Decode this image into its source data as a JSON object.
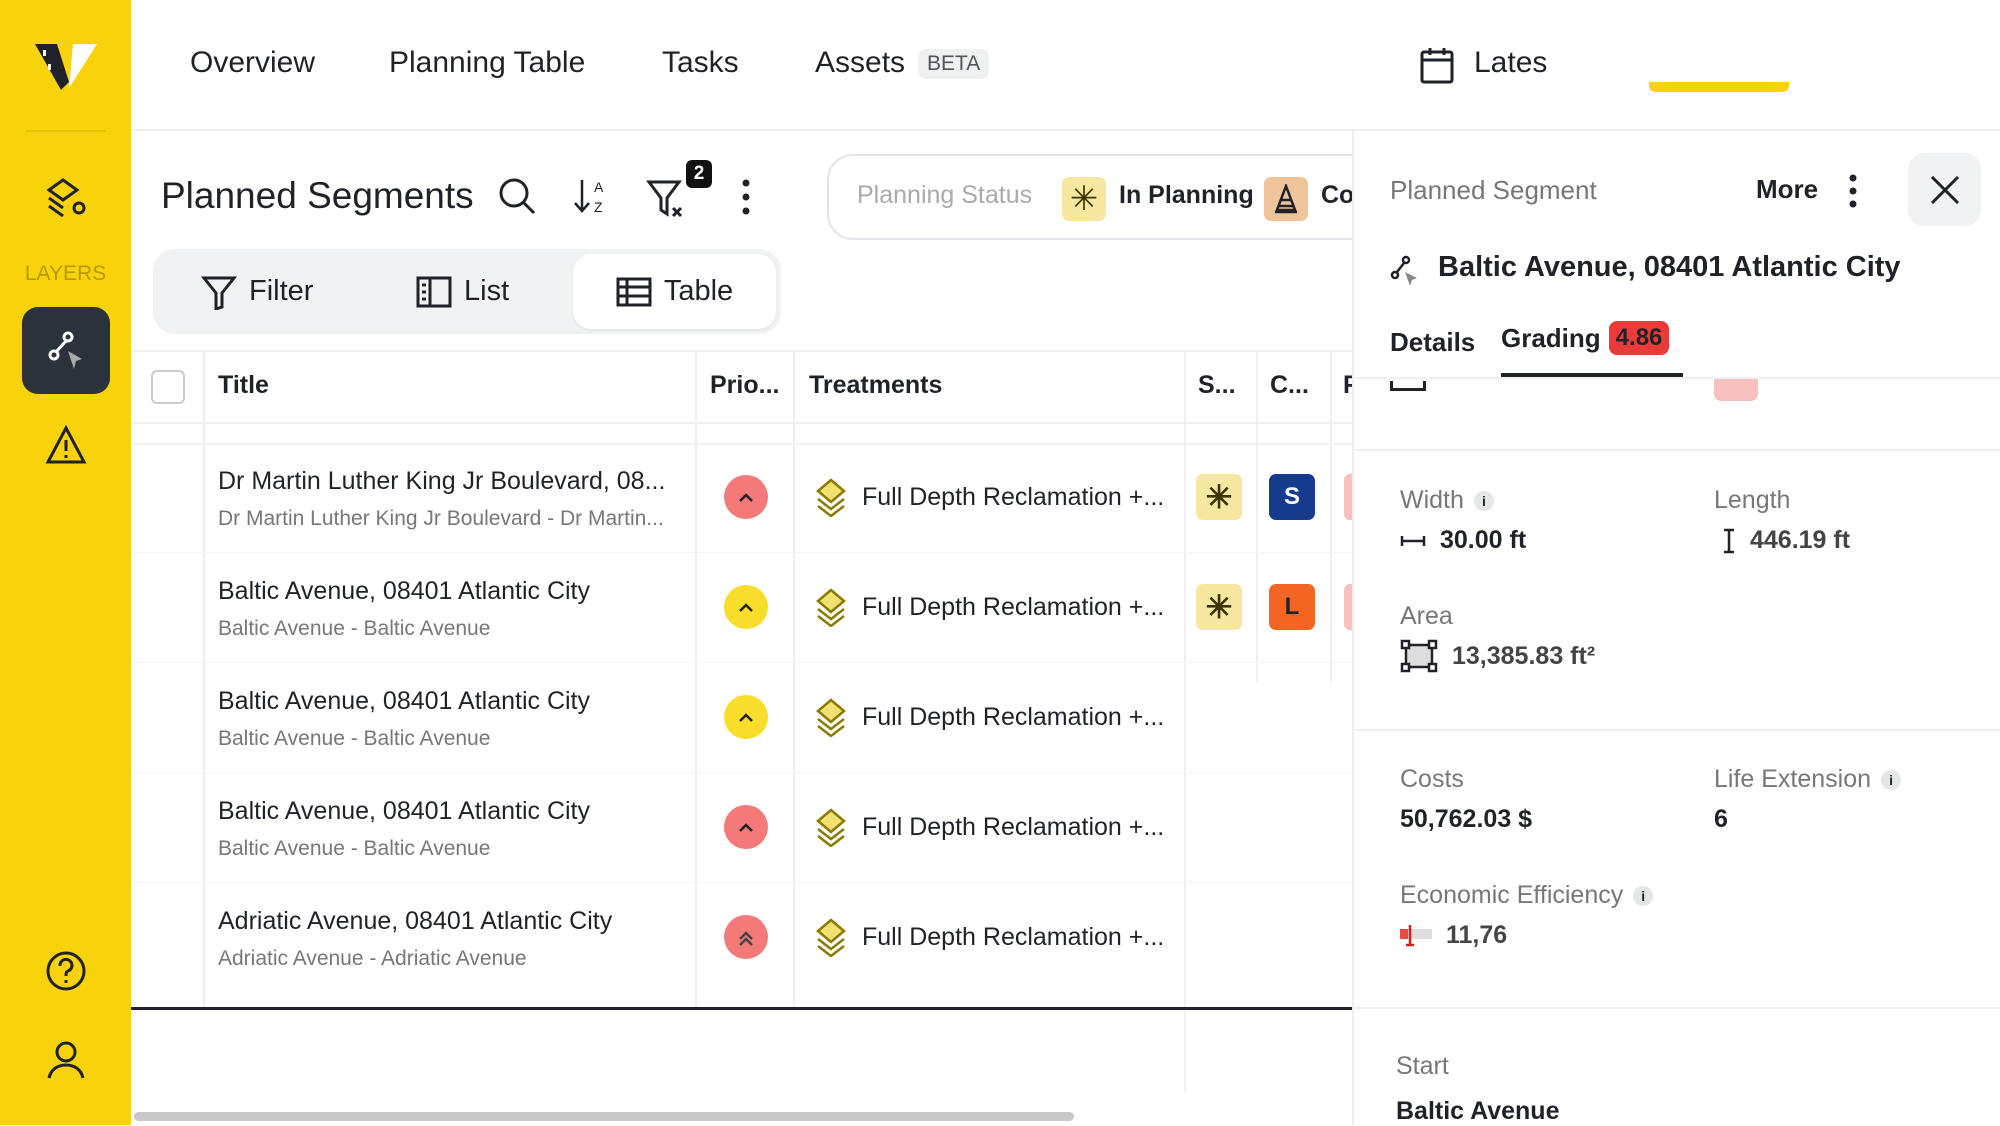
{
  "colors": {
    "brand": "#f8d20a",
    "sidebar_active": "#2a323b",
    "prio_high": "#f47a7a",
    "prio_medium": "#f8de2a",
    "grading_badge": "#ea3a3a",
    "status_planning": "#f6e8a0",
    "cone": "#f0c49a",
    "badge_s": "#163a8c",
    "badge_l": "#f26522"
  },
  "sidebar": {
    "layers_label": "LAYERS",
    "icons": [
      "logo",
      "layers-settings-icon",
      "segment-icon",
      "warning-icon",
      "help-icon",
      "user-icon"
    ]
  },
  "nav": {
    "items": [
      "Overview",
      "Planning Table",
      "Tasks",
      "Assets"
    ],
    "beta": "BETA",
    "date_label": "Lates"
  },
  "list": {
    "title": "Planned Segments",
    "filter_count": "2",
    "planning_status": {
      "placeholder": "Planning Status",
      "value": "In Planning",
      "next": "Co"
    },
    "view": {
      "filter": "Filter",
      "list": "List",
      "table": "Table",
      "active": "Table"
    },
    "columns": [
      "Title",
      "Prio...",
      "Treatments",
      "S...",
      "C...",
      "F"
    ],
    "rows": [
      {
        "title": "Dr Martin Luther King Jr Boulevard, 08...",
        "subtitle": "Dr Martin Luther King Jr Boulevard - Dr Martin...",
        "priority": "high",
        "treatment": "Full Depth Reclamation +...",
        "status": "in-planning",
        "category": "S"
      },
      {
        "title": "Baltic Avenue, 08401 Atlantic City",
        "subtitle": "Baltic Avenue - Baltic Avenue",
        "priority": "medium",
        "treatment": "Full Depth Reclamation +...",
        "status": "in-planning",
        "category": "L"
      },
      {
        "title": "Baltic Avenue, 08401 Atlantic City",
        "subtitle": "Baltic Avenue - Baltic Avenue",
        "priority": "medium",
        "treatment": "Full Depth Reclamation +..."
      },
      {
        "title": "Baltic Avenue, 08401 Atlantic City",
        "subtitle": "Baltic Avenue - Baltic Avenue",
        "priority": "high",
        "treatment": "Full Depth Reclamation +..."
      },
      {
        "title": "Adriatic Avenue, 08401 Atlantic City",
        "subtitle": "Adriatic Avenue - Adriatic Avenue",
        "priority": "very-high",
        "treatment": "Full Depth Reclamation +..."
      }
    ]
  },
  "panel": {
    "heading": "Planned Segment",
    "more": "More",
    "title": "Baltic Avenue, 08401 Atlantic City",
    "tabs": {
      "details": "Details",
      "grading": "Grading",
      "grading_score": "4.86",
      "active": "Grading"
    },
    "width": {
      "label": "Width",
      "value": "30.00 ft"
    },
    "length": {
      "label": "Length",
      "value": "446.19 ft"
    },
    "area": {
      "label": "Area",
      "value": "13,385.83 ft²"
    },
    "costs": {
      "label": "Costs",
      "value": "50,762.03 $"
    },
    "life_extension": {
      "label": "Life Extension",
      "value": "6"
    },
    "economic_efficiency": {
      "label": "Economic Efficiency",
      "value": "11,76"
    },
    "start": {
      "label": "Start",
      "value": "Baltic Avenue"
    }
  }
}
